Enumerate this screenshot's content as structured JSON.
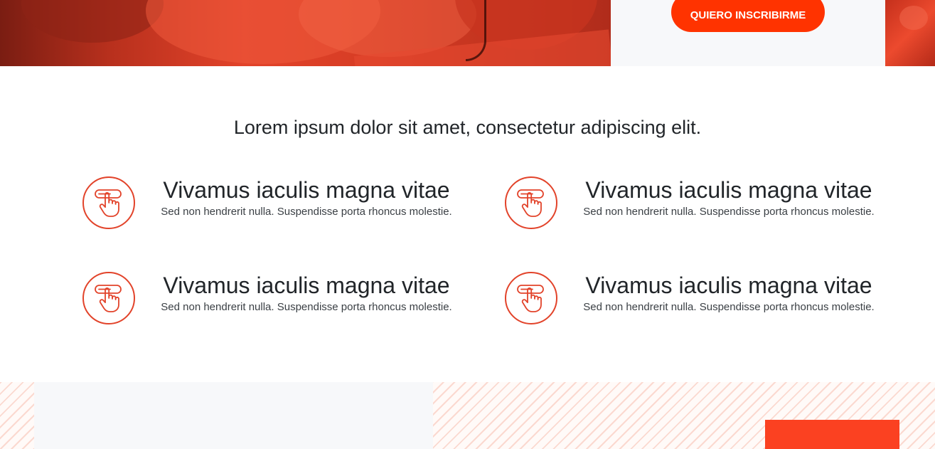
{
  "hero": {
    "cta_label": "QUIERO INSCRIBIRME"
  },
  "features_section": {
    "heading": "Lorem ipsum dolor sit amet, consectetur adipiscing elit.",
    "icon": "hand-pointer-click-icon",
    "accent_color": "#e2432a",
    "items": [
      {
        "title": "Vivamus iaculis magna vitae",
        "description": "Sed non hendrerit nulla. Suspendisse porta rhoncus molestie."
      },
      {
        "title": "Vivamus iaculis magna vitae",
        "description": "Sed non hendrerit nulla. Suspendisse porta rhoncus molestie."
      },
      {
        "title": "Vivamus iaculis magna vitae",
        "description": "Sed non hendrerit nulla. Suspendisse porta rhoncus molestie."
      },
      {
        "title": "Vivamus iaculis magna vitae",
        "description": "Sed non hendrerit nulla. Suspendisse porta rhoncus molestie."
      }
    ]
  },
  "colors": {
    "brand_orange": "#ff3300",
    "panel_gray": "#f7f8fa"
  }
}
